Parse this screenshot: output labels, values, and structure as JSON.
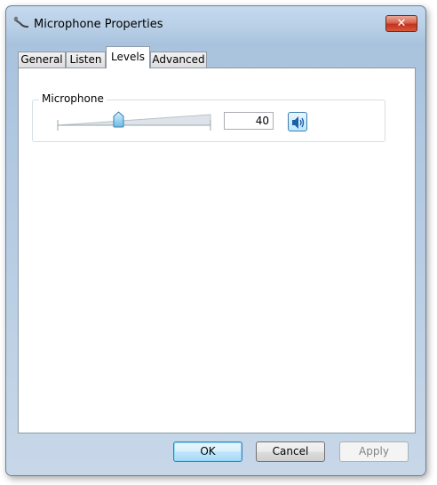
{
  "window": {
    "title": "Microphone Properties",
    "close_label": "✕"
  },
  "tabs": [
    {
      "label": "General",
      "active": false
    },
    {
      "label": "Listen",
      "active": false
    },
    {
      "label": "Levels",
      "active": true
    },
    {
      "label": "Advanced",
      "active": false
    }
  ],
  "levels": {
    "group_label": "Microphone",
    "slider_value": 40,
    "slider_max": 100,
    "value_text": "40"
  },
  "buttons": {
    "ok": "OK",
    "cancel": "Cancel",
    "apply": "Apply"
  },
  "colors": {
    "accent": "#3c7fb1",
    "close": "#c2331f"
  },
  "icons": {
    "title": "microphone-icon",
    "mute": "speaker-icon"
  }
}
